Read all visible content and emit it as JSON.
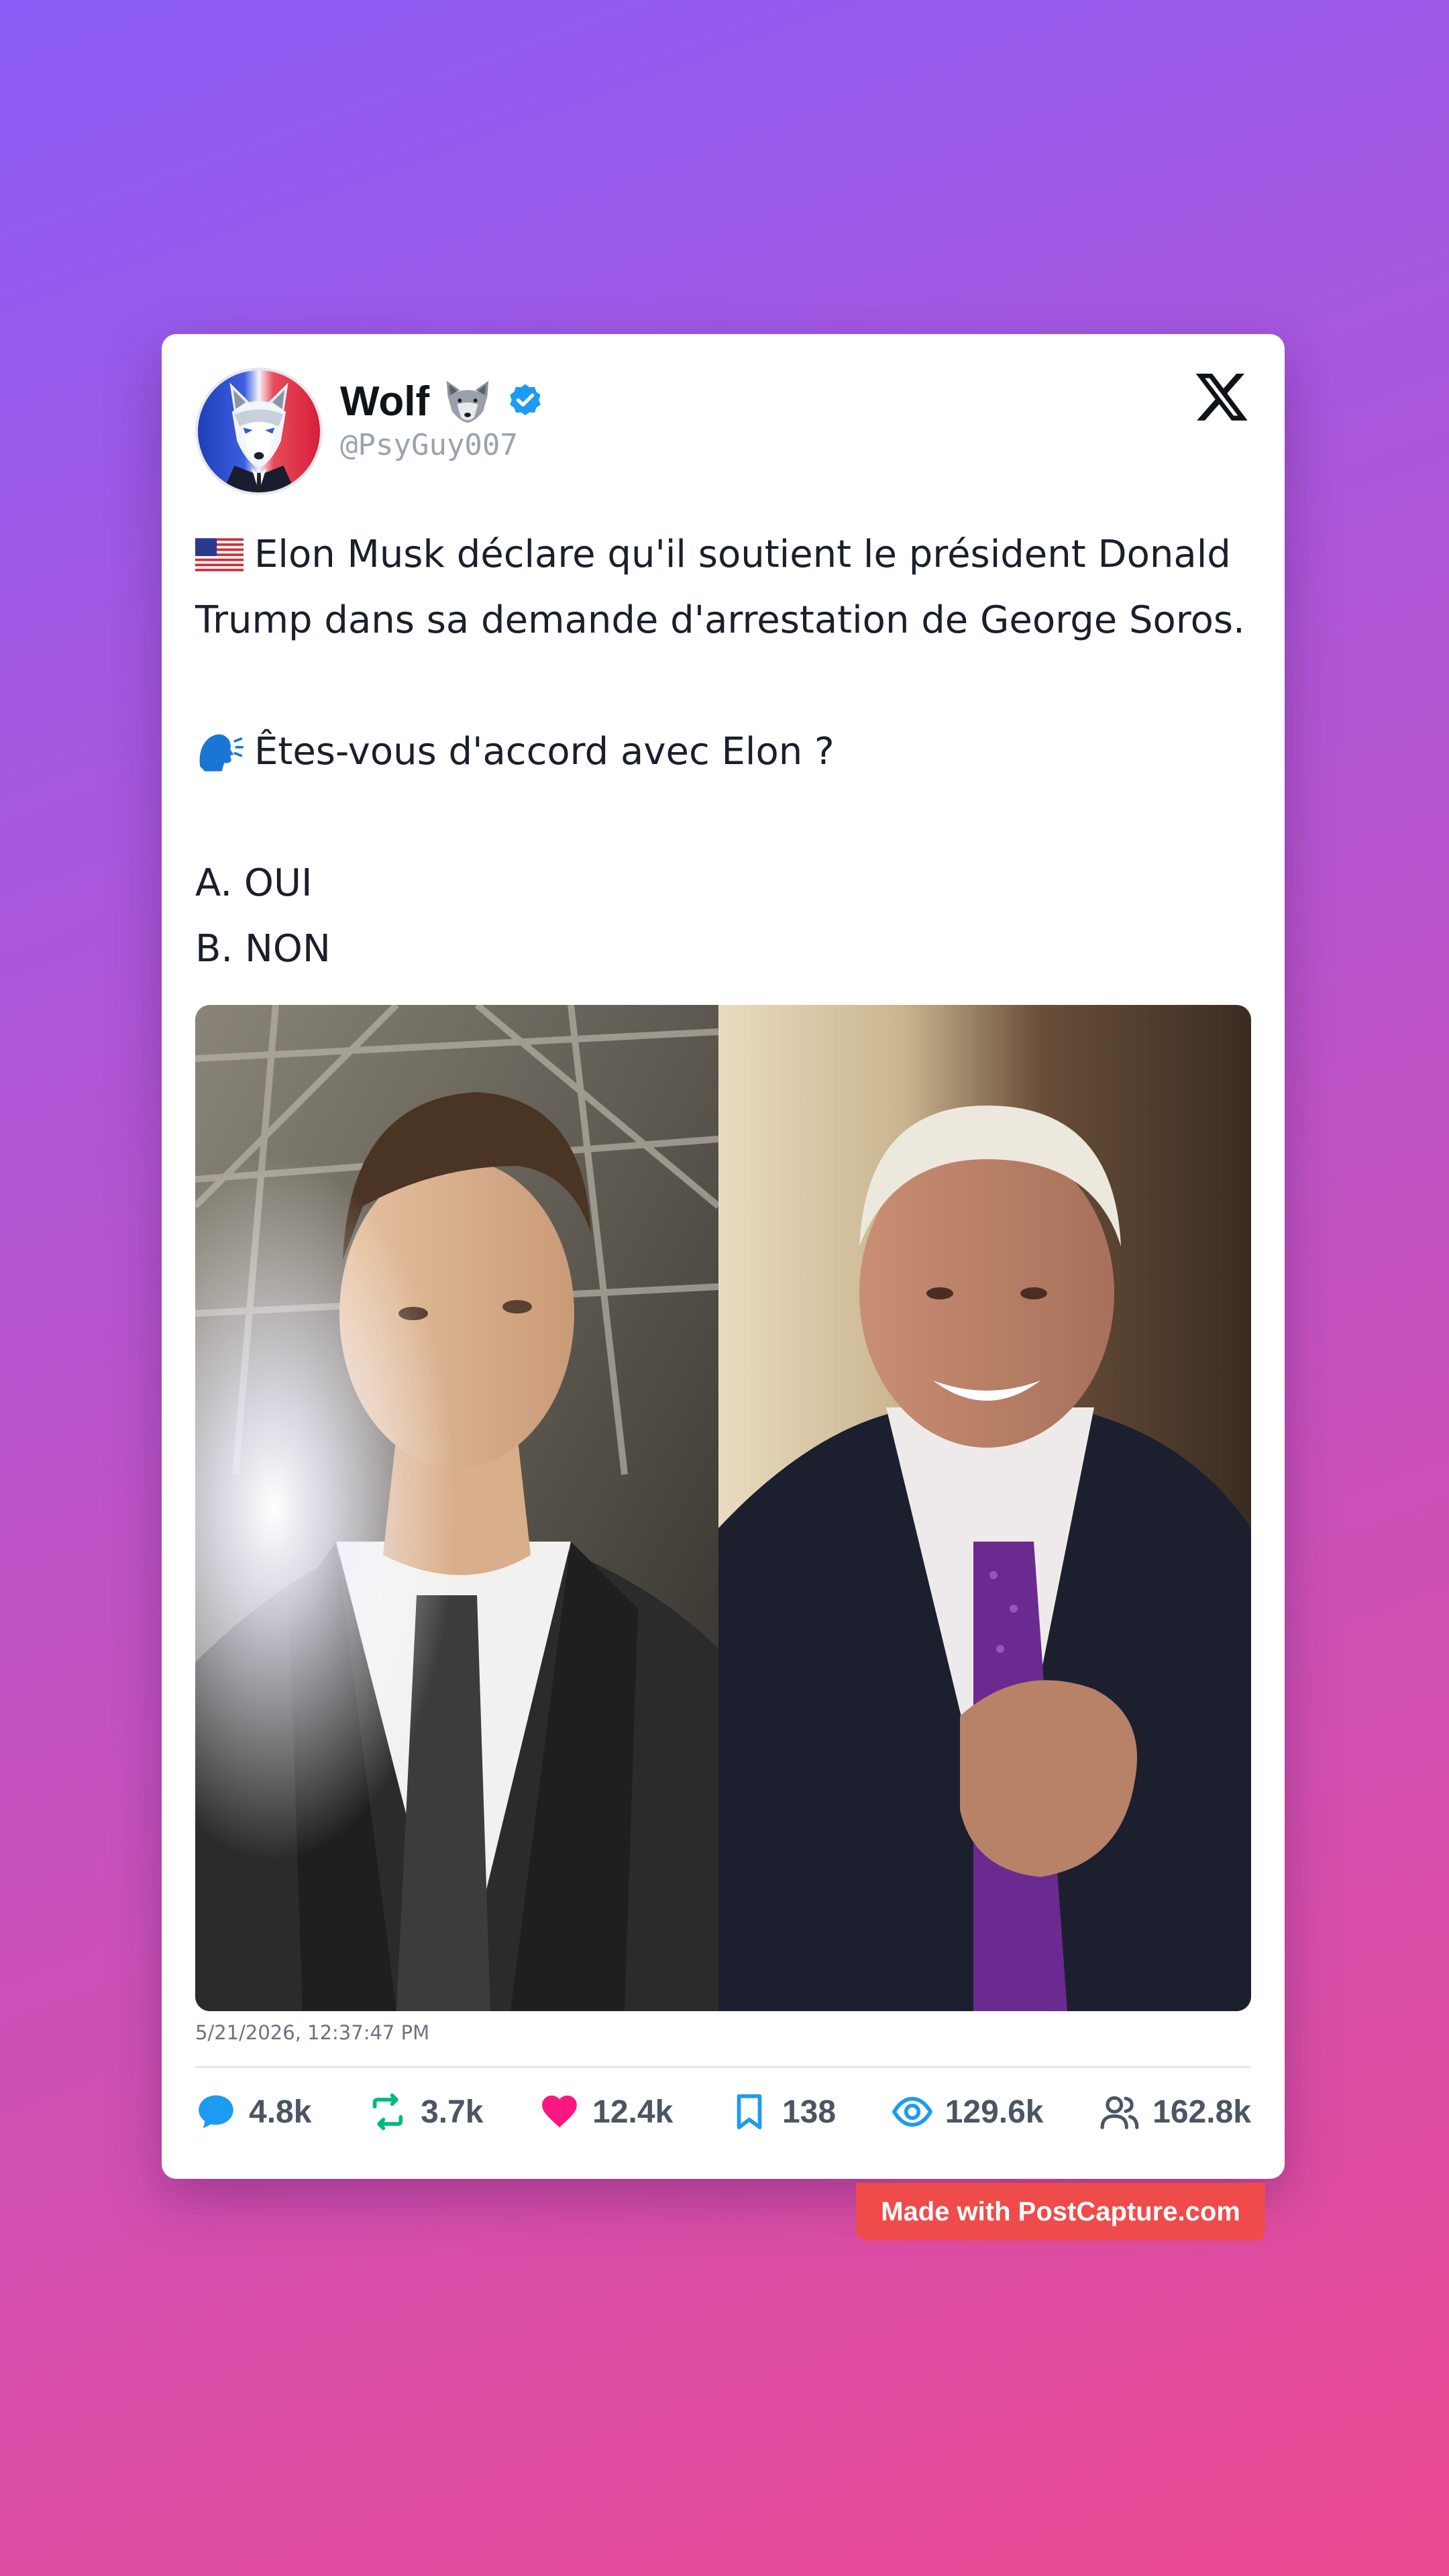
{
  "author": {
    "name": "Wolf",
    "handle": "@PsyGuy007",
    "verified": true,
    "avatar_icon": "wolf-in-suit-avatar",
    "name_emoji_icon": "wolf-face-icon"
  },
  "tweet": {
    "lines": [
      {
        "icon": "us-flag-icon",
        "text": "Elon Musk déclare qu'il soutient le président Donald"
      },
      {
        "icon": "",
        "text": "Trump dans sa demande d'arrestation de George Soros."
      },
      {
        "icon": "",
        "text": ""
      },
      {
        "icon": "speaking-head-icon",
        "text": "Êtes-vous d'accord avec Elon ?"
      },
      {
        "icon": "",
        "text": ""
      },
      {
        "icon": "",
        "text": "A. OUI"
      },
      {
        "icon": "",
        "text": "B. NON"
      }
    ],
    "timestamp": "5/21/2026, 12:37:47 PM",
    "media": [
      "photo-man-in-suit-looking-up",
      "photo-elderly-man-smiling-purple-tie"
    ]
  },
  "stats": {
    "replies": "4.8k",
    "reposts": "3.7k",
    "likes": "12.4k",
    "bookmarks": "138",
    "views": "129.6k",
    "followers": "162.8k"
  },
  "watermark": "Made with PostCapture.com",
  "colors": {
    "background_start": "#8b5cf6",
    "background_end": "#ec4a92",
    "reply": "#1d9bf0",
    "repost": "#00ba7c",
    "like": "#f91880",
    "bookmark": "#1d9bf0",
    "views": "#1d9bf0",
    "badge": "#ef4b4b"
  }
}
